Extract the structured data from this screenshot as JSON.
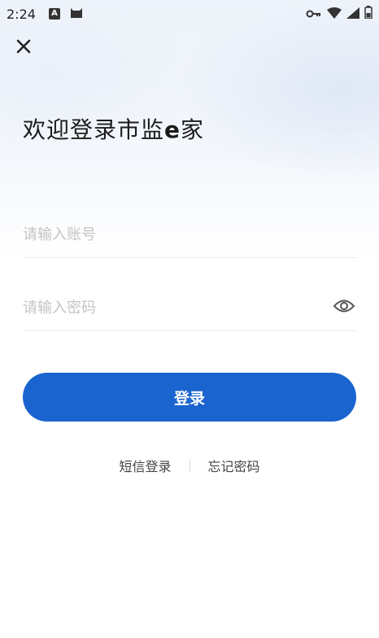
{
  "status_bar": {
    "time": "2:24",
    "left_icons": [
      "a-icon",
      "cat-icon"
    ],
    "right_icons": [
      "key-icon",
      "wifi-icon",
      "signal-icon",
      "battery-icon"
    ]
  },
  "header": {
    "close_icon": "close-icon"
  },
  "title": {
    "prefix": "欢迎登录市监",
    "highlight": "e",
    "suffix": "家"
  },
  "form": {
    "account_placeholder": "请输入账号",
    "account_value": "",
    "password_placeholder": "请输入密码",
    "password_value": "",
    "eye_icon": "eye-icon",
    "login_label": "登录"
  },
  "links": {
    "sms_login": "短信登录",
    "forgot_password": "忘记密码"
  },
  "colors": {
    "primary": "#1a64cf",
    "background_top": "#eef3fb"
  }
}
